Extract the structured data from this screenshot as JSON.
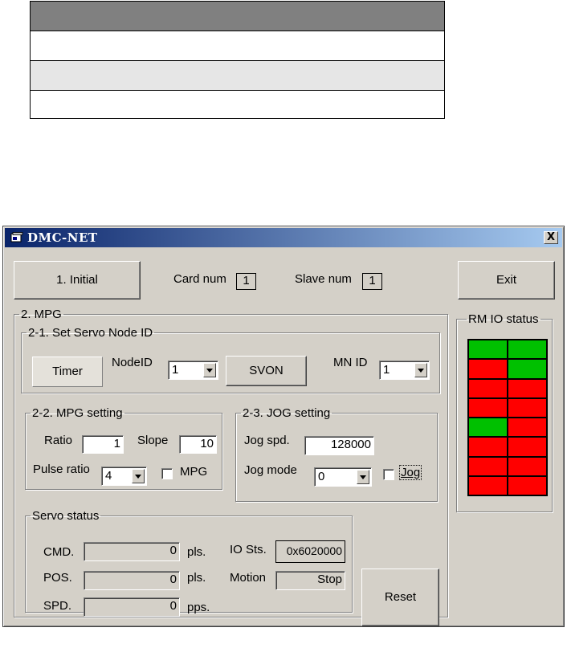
{
  "window": {
    "title": "DMC-NET",
    "close_glyph": "X"
  },
  "initial_button": "1. Initial",
  "card_num": {
    "label": "Card num",
    "value": "1"
  },
  "slave_num": {
    "label": "Slave num",
    "value": "1"
  },
  "exit_button": "Exit",
  "mpg_group": {
    "legend": "2. MPG"
  },
  "servo_node": {
    "legend": "2-1. Set Servo Node ID",
    "timer_button": "Timer",
    "nodeid_label": "NodeID",
    "nodeid_value": "1",
    "svon_button": "SVON",
    "mnid_label": "MN ID",
    "mnid_value": "1"
  },
  "mpg_setting": {
    "legend": "2-2. MPG setting",
    "ratio_label": "Ratio",
    "ratio_value": "1",
    "slope_label": "Slope",
    "slope_value": "10",
    "pulse_ratio_label": "Pulse ratio",
    "pulse_ratio_value": "4",
    "mpg_check_label": "MPG"
  },
  "jog_setting": {
    "legend": "2-3. JOG setting",
    "jog_spd_label": "Jog spd.",
    "jog_spd_value": "128000",
    "jog_mode_label": "Jog mode",
    "jog_mode_value": "0",
    "jog_check_label": "Jog"
  },
  "servo_status": {
    "legend": "Servo status",
    "cmd_label": "CMD.",
    "cmd_value": "0",
    "cmd_unit": "pls.",
    "pos_label": "POS.",
    "pos_value": "0",
    "pos_unit": "pls.",
    "spd_label": "SPD.",
    "spd_value": "0",
    "spd_unit": "pps.",
    "io_label": "IO Sts.",
    "io_value": "0x6020000",
    "motion_label": "Motion",
    "motion_value": "Stop"
  },
  "reset_button": "Reset",
  "rm_io": {
    "legend": "RM IO status",
    "colors": {
      "on": "#00c000",
      "off": "#ff0000"
    },
    "cells": [
      [
        "on",
        "on"
      ],
      [
        "off",
        "on"
      ],
      [
        "off",
        "off"
      ],
      [
        "off",
        "off"
      ],
      [
        "on",
        "off"
      ],
      [
        "off",
        "off"
      ],
      [
        "off",
        "off"
      ],
      [
        "off",
        "off"
      ]
    ]
  },
  "colors": {
    "title_start": "#0a246a",
    "title_end": "#a6caf0",
    "face": "#d4d0c8",
    "table_header": "#808080",
    "table_alt": "#e6e6e6"
  }
}
